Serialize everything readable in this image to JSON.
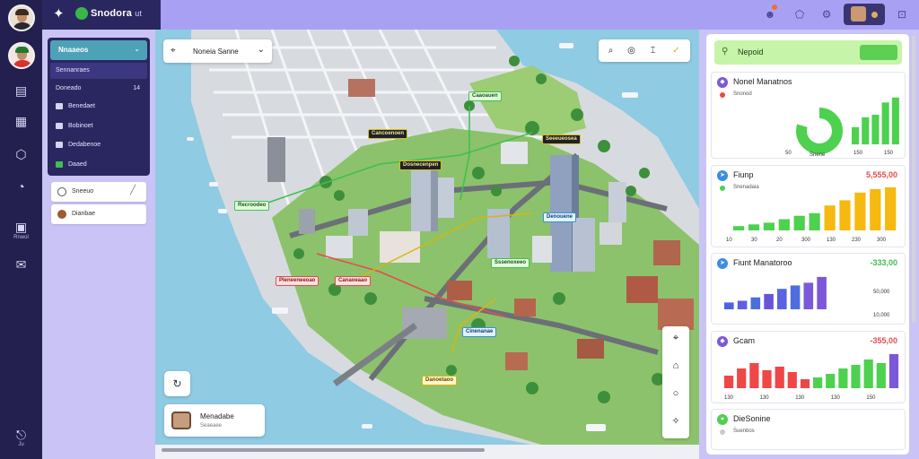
{
  "app": {
    "brand": "Snodora",
    "brand_suffix": "ut"
  },
  "rail": {
    "labels": [
      "Rnwol",
      "Ju"
    ]
  },
  "nav": {
    "header": "Nnaaeos",
    "items": [
      {
        "label": "Sennanraes",
        "count": ""
      },
      {
        "label": "Doneado",
        "count": "14"
      },
      {
        "label": "Benedaet",
        "count": ""
      },
      {
        "label": "Bobinoet",
        "count": ""
      },
      {
        "label": "Dedabenoe",
        "count": ""
      },
      {
        "label": "Daaed",
        "count": ""
      }
    ],
    "buttons": [
      {
        "label": "Sneeuo"
      },
      {
        "label": "Dianbae"
      }
    ]
  },
  "map": {
    "search_label": "Noneia Sanne",
    "info_card": {
      "title": "Menadabe",
      "subtitle": "Seaeaee"
    },
    "tags": [
      {
        "label": "Cancoenoen",
        "style": "dark"
      },
      {
        "label": "Caaoauen",
        "style": "green"
      },
      {
        "label": "Dosnecenpen",
        "style": "dark"
      },
      {
        "label": "Seeeueosea",
        "style": "dark"
      },
      {
        "label": "Recroodeo",
        "style": "green"
      },
      {
        "label": "Denouene",
        "style": "blue"
      },
      {
        "label": "Sssenoxeeo",
        "style": "green"
      },
      {
        "label": "Pleneeneeoao",
        "style": "red"
      },
      {
        "label": "Canaoeaao",
        "style": "red"
      },
      {
        "label": "Cinenanae",
        "style": "blue"
      },
      {
        "label": "Danoetaoo",
        "style": "yellow"
      }
    ]
  },
  "right": {
    "header": "Nepoid",
    "header_button": "",
    "cards": [
      {
        "title": "Nonel Manatnos",
        "sub": "Snonod",
        "value": "",
        "gauge_label": "Snene",
        "gauge_side": "50",
        "x_labels": [
          "150",
          "150"
        ],
        "chart_data": {
          "type": "bar",
          "values": [
            35,
            55,
            60,
            85,
            95
          ]
        }
      },
      {
        "title": "Fiunp",
        "sub": "Snenadaia",
        "value": "5,555,00",
        "x_labels": [
          "10",
          "30",
          "20",
          "300",
          "130",
          "230",
          "300"
        ],
        "chart_data": {
          "type": "bar",
          "values": [
            10,
            14,
            18,
            26,
            34,
            40,
            58,
            70,
            88,
            96,
            100
          ]
        }
      },
      {
        "title": "Fiunt Manatoroo",
        "sub": "",
        "value": "-333,00",
        "y_labels": [
          "50,000",
          "10,000"
        ],
        "chart_data": {
          "type": "bar",
          "values": [
            20,
            25,
            35,
            45,
            60,
            70,
            78,
            95
          ]
        }
      },
      {
        "title": "Gcam",
        "sub": "",
        "value": "-355,00",
        "x_labels": [
          "130",
          "130",
          "130",
          "130",
          "150"
        ],
        "chart_data": {
          "type": "bar",
          "values": [
            35,
            55,
            70,
            50,
            60,
            45,
            25,
            30,
            40,
            55,
            65,
            80,
            70,
            95
          ]
        }
      },
      {
        "title": "DieSonine",
        "sub": "Suenbos",
        "value": ""
      }
    ]
  },
  "colors": {
    "accent": "#a8a1f3",
    "rail": "#23204f",
    "green": "#4dd14f",
    "gold": "#f5b90f",
    "purple": "#7c58d9",
    "red": "#ef4747"
  }
}
